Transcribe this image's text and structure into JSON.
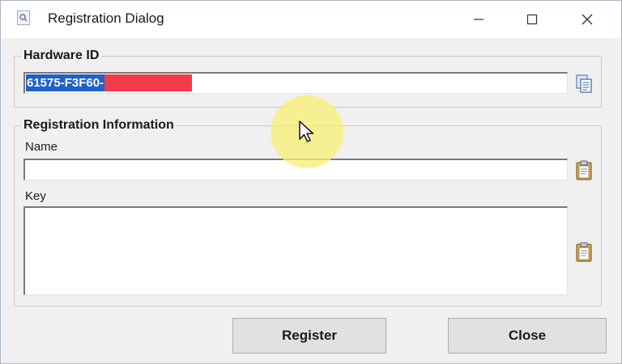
{
  "window": {
    "title": "Registration Dialog",
    "icon": "app-icon"
  },
  "titlebar_buttons": {
    "minimize": "minimize-icon",
    "maximize": "maximize-icon",
    "close": "close-icon"
  },
  "hardware_group": {
    "legend": "Hardware ID",
    "value": "61575-F3F60-",
    "value_selected": true,
    "redacted_color": "#f23c4a",
    "copy_icon": "copy-icon"
  },
  "registration_group": {
    "legend": "Registration Information",
    "name_label": "Name",
    "name_value": "",
    "key_label": "Key",
    "key_value": "",
    "paste_icon": "paste-icon"
  },
  "buttons": {
    "register": "Register",
    "close": "Close"
  },
  "colors": {
    "selection": "#1f62c7",
    "cursor_highlight": "#f8f078"
  }
}
